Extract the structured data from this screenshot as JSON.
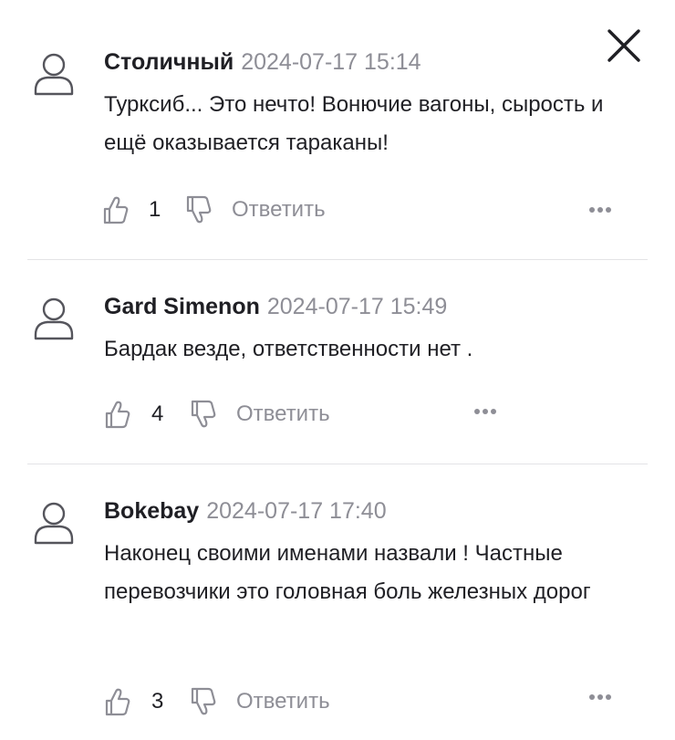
{
  "close_label": "close",
  "comments": [
    {
      "author": "Столичный",
      "date": "2024-07-17 15:14",
      "text": "Турксиб... Это нечто! Вонючие вагоны, сырость и ещё оказывается тараканы!",
      "likes": "1",
      "reply_label": "Ответить"
    },
    {
      "author": "Gard Simenon",
      "date": "2024-07-17 15:49",
      "text": "Бардак везде, ответственности нет .",
      "likes": "4",
      "reply_label": "Ответить"
    },
    {
      "author": "Bokebay",
      "date": "2024-07-17 17:40",
      "text": "Наконец своими именами назвали ! Частные перевозчики это головная боль железных дорог",
      "likes": "3",
      "reply_label": "Ответить"
    }
  ],
  "icons": {
    "avatar": "user-outline-icon",
    "like": "thumb-up-icon",
    "dislike": "thumb-down-icon",
    "more": "more-dots-icon",
    "close": "close-x-icon"
  },
  "colors": {
    "text": "#1f1f24",
    "muted": "#8e8e96",
    "divider": "#e3e3e6"
  }
}
